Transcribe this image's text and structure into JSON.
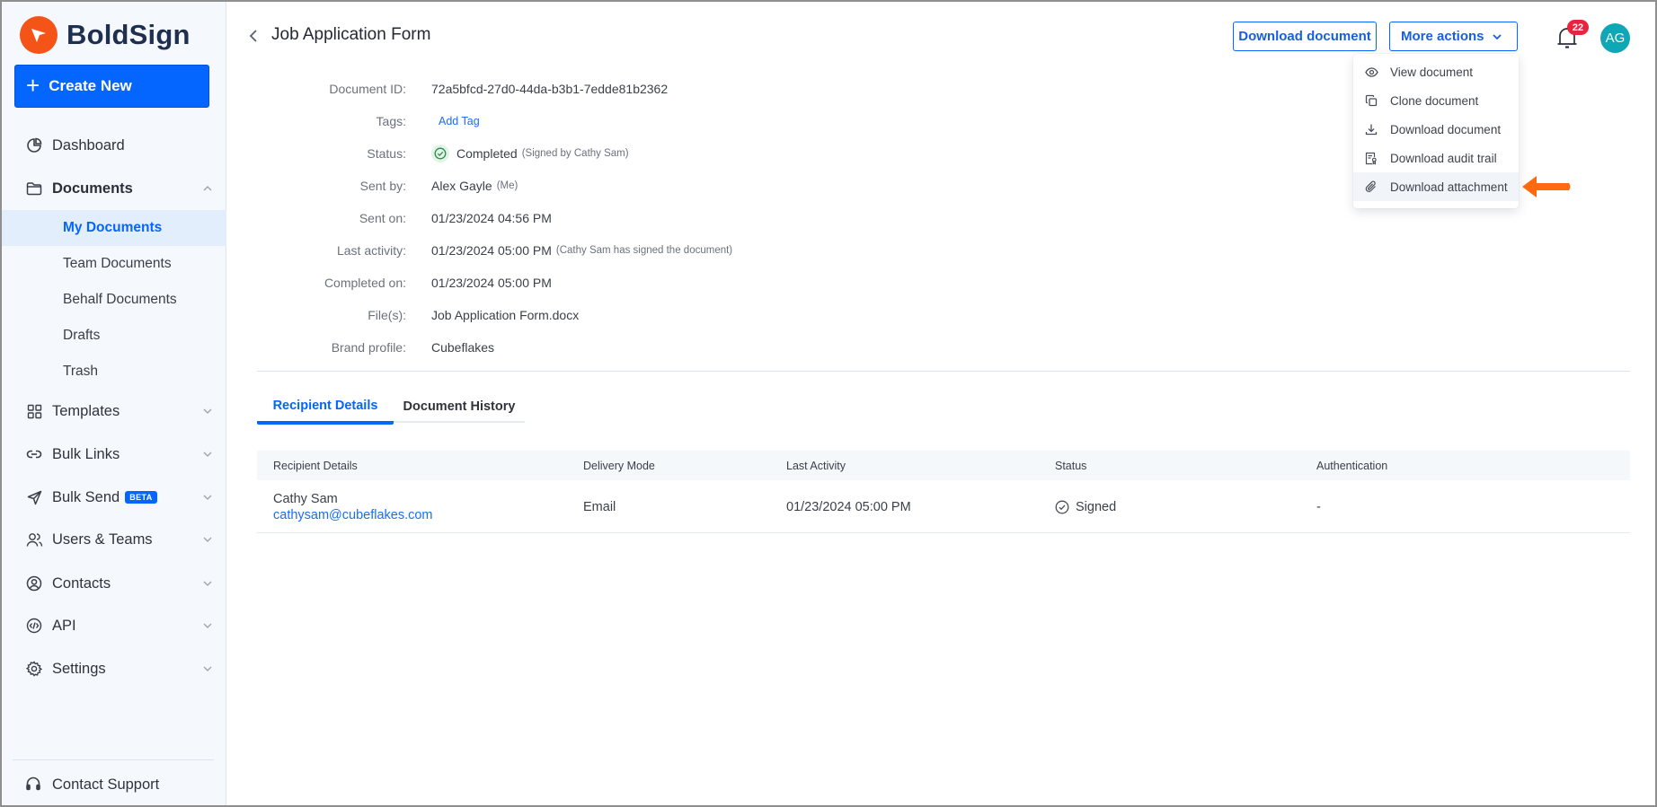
{
  "brand": {
    "name": "BoldSign",
    "accent": "#0565ff",
    "logo_color": "#f45418"
  },
  "sidebar": {
    "create_label": "Create New",
    "items": [
      {
        "label": "Dashboard",
        "icon": "pie-chart-icon"
      },
      {
        "label": "Documents",
        "icon": "folder-icon",
        "expanded": true
      },
      {
        "label": "Templates",
        "icon": "grid-icon"
      },
      {
        "label": "Bulk Links",
        "icon": "link-icon"
      },
      {
        "label": "Bulk Send",
        "icon": "send-icon",
        "badge": "BETA"
      },
      {
        "label": "Users & Teams",
        "icon": "users-icon"
      },
      {
        "label": "Contacts",
        "icon": "contact-icon"
      },
      {
        "label": "API",
        "icon": "code-icon"
      },
      {
        "label": "Settings",
        "icon": "gear-icon"
      }
    ],
    "sub_items": [
      {
        "label": "My Documents",
        "active": true
      },
      {
        "label": "Team Documents"
      },
      {
        "label": "Behalf Documents"
      },
      {
        "label": "Drafts"
      },
      {
        "label": "Trash"
      }
    ],
    "support_label": "Contact Support"
  },
  "header": {
    "title": "Job Application Form",
    "download_label": "Download document",
    "more_actions_label": "More actions",
    "notification_count": "22",
    "avatar_initials": "AG"
  },
  "more_actions_menu": [
    {
      "label": "View document",
      "icon": "eye-icon"
    },
    {
      "label": "Clone document",
      "icon": "clone-icon"
    },
    {
      "label": "Download document",
      "icon": "download-icon"
    },
    {
      "label": "Download audit trail",
      "icon": "audit-trail-icon"
    },
    {
      "label": "Download attachment",
      "icon": "paperclip-icon",
      "highlighted": true
    }
  ],
  "details": {
    "document_id": {
      "label": "Document ID:",
      "value": "72a5bfcd-27d0-44da-b3b1-7edde81b2362"
    },
    "tags": {
      "label": "Tags:",
      "action": "Add Tag"
    },
    "status": {
      "label": "Status:",
      "value": "Completed",
      "note": "(Signed by Cathy Sam)"
    },
    "sent_by": {
      "label": "Sent by:",
      "value": "Alex Gayle",
      "note": "(Me)"
    },
    "sent_on": {
      "label": "Sent on:",
      "value": "01/23/2024 04:56 PM"
    },
    "last_activity": {
      "label": "Last activity:",
      "value": "01/23/2024 05:00 PM",
      "note": "(Cathy Sam has signed the document)"
    },
    "completed_on": {
      "label": "Completed on:",
      "value": "01/23/2024 05:00 PM"
    },
    "files": {
      "label": "File(s):",
      "value": "Job Application Form.docx"
    },
    "brand_profile": {
      "label": "Brand profile:",
      "value": "Cubeflakes"
    }
  },
  "tabs": [
    {
      "label": "Recipient Details",
      "active": true
    },
    {
      "label": "Document History"
    }
  ],
  "table": {
    "columns": [
      "Recipient Details",
      "Delivery Mode",
      "Last Activity",
      "Status",
      "Authentication"
    ],
    "rows": [
      {
        "name": "Cathy Sam",
        "email": "cathysam@cubeflakes.com",
        "delivery_mode": "Email",
        "last_activity": "01/23/2024 05:00 PM",
        "status": "Signed",
        "authentication": "-"
      }
    ]
  }
}
